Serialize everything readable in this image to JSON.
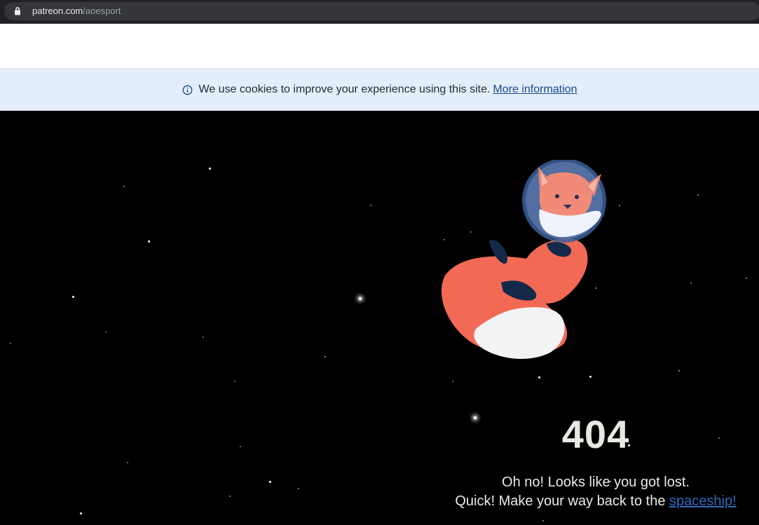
{
  "browser": {
    "url_domain": "patreon.com",
    "url_path": "/aoesport"
  },
  "cookie_banner": {
    "text": "We use cookies to improve your experience using this site.",
    "link_label": "More information",
    "icon": "info-icon"
  },
  "error": {
    "code": "404",
    "line1": "Oh no! Looks like you got lost.",
    "line2_prefix": "Quick! Make your way back to the ",
    "link_label": "spaceship!"
  },
  "colors": {
    "banner_bg": "#e3eefa",
    "link": "#2f67b8",
    "space_bg": "#000000",
    "fox": "#f26a55"
  }
}
